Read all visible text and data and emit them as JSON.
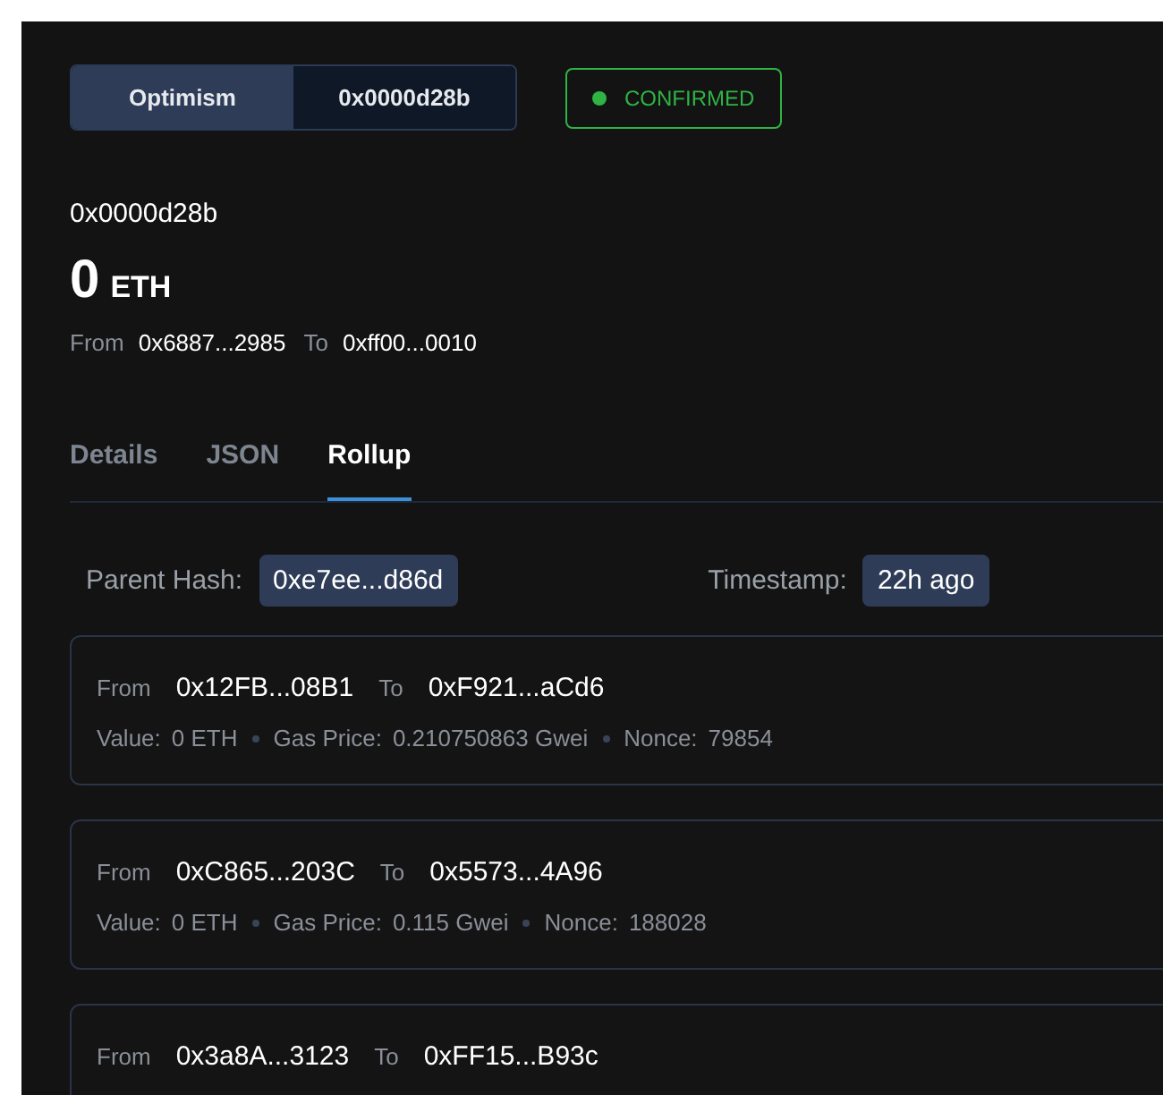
{
  "chain_switch": [
    {
      "label": "Optimism",
      "selected": true
    },
    {
      "label": "0x0000d28b",
      "selected": false
    }
  ],
  "status": {
    "label": "CONFIRMED",
    "color": "#2fb344"
  },
  "tx": {
    "hash": "0x0000d28b",
    "amount": "0",
    "unit": "ETH",
    "from_label": "From",
    "from": "0x6887...2985",
    "to_label": "To",
    "to": "0xff00...0010"
  },
  "tabs": [
    {
      "label": "Details",
      "selected": false
    },
    {
      "label": "JSON",
      "selected": false
    },
    {
      "label": "Rollup",
      "selected": true
    }
  ],
  "rollup": {
    "parent_hash_label": "Parent Hash:",
    "parent_hash": "0xe7ee...d86d",
    "timestamp_label": "Timestamp:",
    "timestamp": "22h ago"
  },
  "transactions": [
    {
      "from_label": "From",
      "from": "0x12FB...08B1",
      "to_label": "To",
      "to": "0xF921...aCd6",
      "details": [
        {
          "label": "Value:",
          "value": "0 ETH"
        },
        {
          "label": "Gas Price:",
          "value": "0.210750863 Gwei"
        },
        {
          "label": "Nonce:",
          "value": "79854"
        }
      ]
    },
    {
      "from_label": "From",
      "from": "0xC865...203C",
      "to_label": "To",
      "to": "0x5573...4A96",
      "details": [
        {
          "label": "Value:",
          "value": "0 ETH"
        },
        {
          "label": "Gas Price:",
          "value": "0.115 Gwei"
        },
        {
          "label": "Nonce:",
          "value": "188028"
        }
      ]
    },
    {
      "from_label": "From",
      "from": "0x3a8A...3123",
      "to_label": "To",
      "to": "0xFF15...B93c"
    }
  ]
}
